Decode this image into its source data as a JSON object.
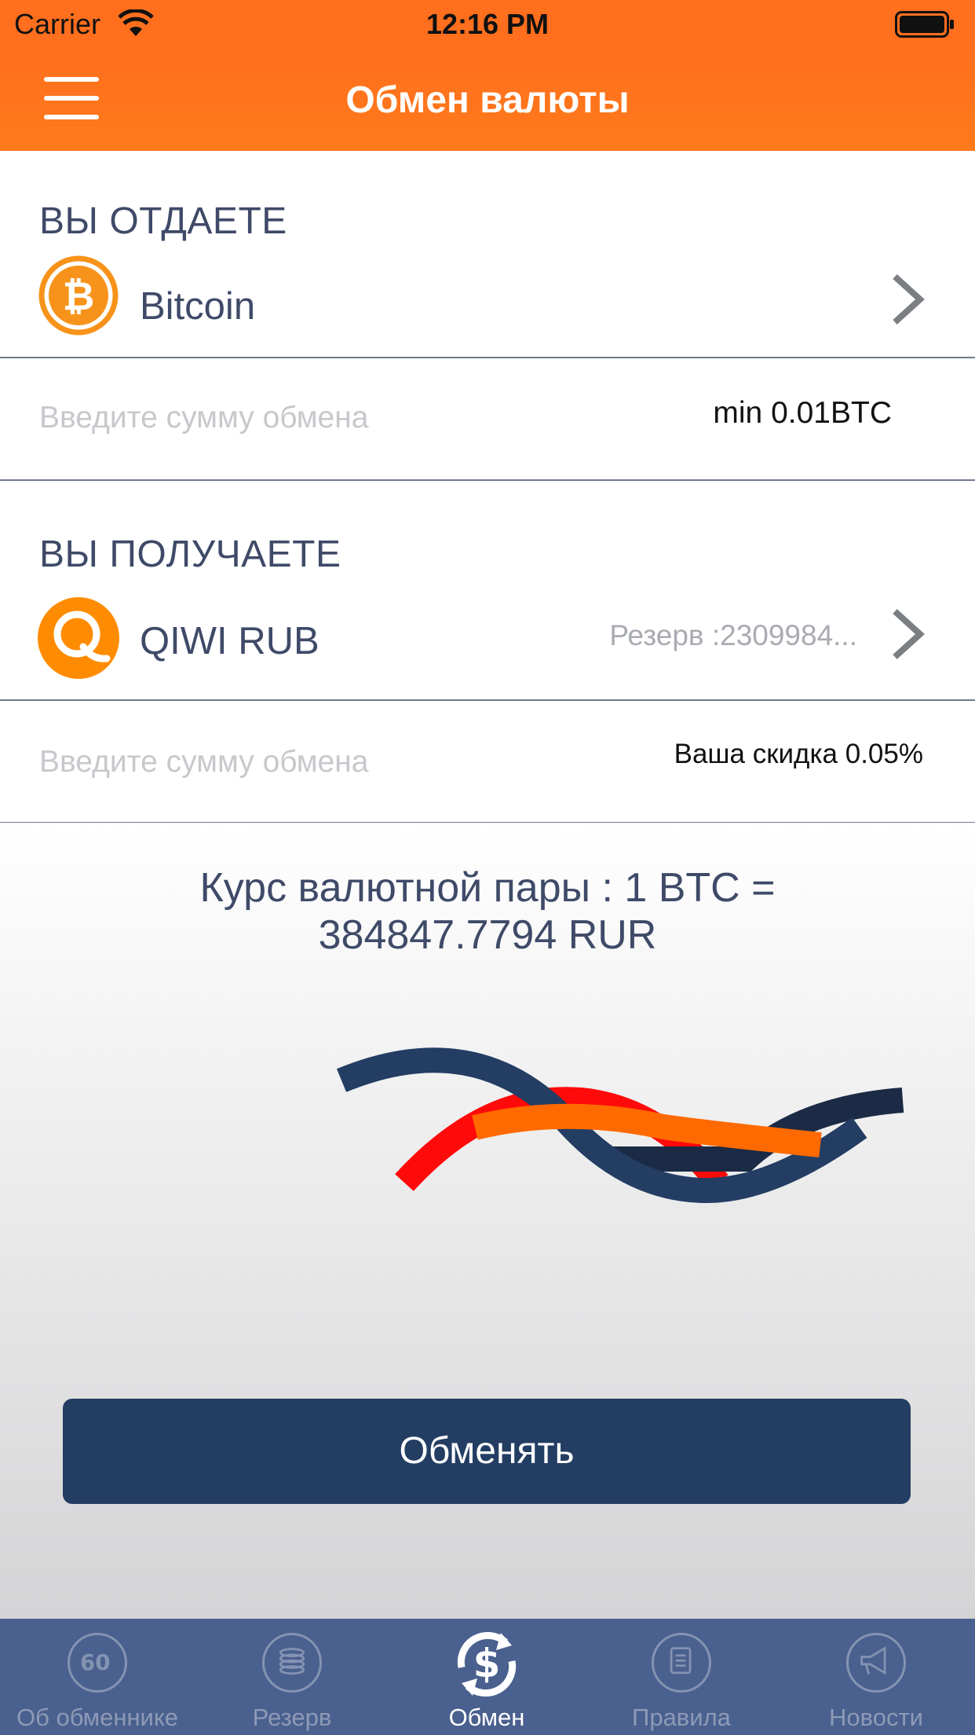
{
  "status_bar": {
    "carrier": "Carrier",
    "time": "12:16 PM"
  },
  "nav": {
    "title": "Обмен валюты"
  },
  "give": {
    "label": "ВЫ ОТДАЕТЕ",
    "currency": "Bitcoin",
    "amount_placeholder": "Введите сумму обмена",
    "min": "min 0.01BTC"
  },
  "receive": {
    "label": "ВЫ ПОЛУЧАЕТЕ",
    "currency": "QIWI RUB",
    "reserve": "Резерв :2309984...",
    "amount_placeholder": "Введите сумму обмена",
    "discount": "Ваша скидка 0.05%"
  },
  "rate": {
    "line1": "Курс валютной пары : 1 BTC =",
    "line2": "384847.7794 RUR"
  },
  "exchange_button": "Обменять",
  "tabs": [
    {
      "label": "Об обменнике",
      "icon": "about-icon"
    },
    {
      "label": "Резерв",
      "icon": "coins-icon"
    },
    {
      "label": "Обмен",
      "icon": "exchange-icon",
      "active": true
    },
    {
      "label": "Правила",
      "icon": "rules-icon"
    },
    {
      "label": "Новости",
      "icon": "megaphone-icon"
    }
  ],
  "colors": {
    "accent": "#ff6f1e",
    "text": "#3f4a68",
    "button": "#233d63",
    "tab_bar": "#4a608e",
    "bitcoin": "#f7931a",
    "qiwi": "#ff8c00"
  }
}
